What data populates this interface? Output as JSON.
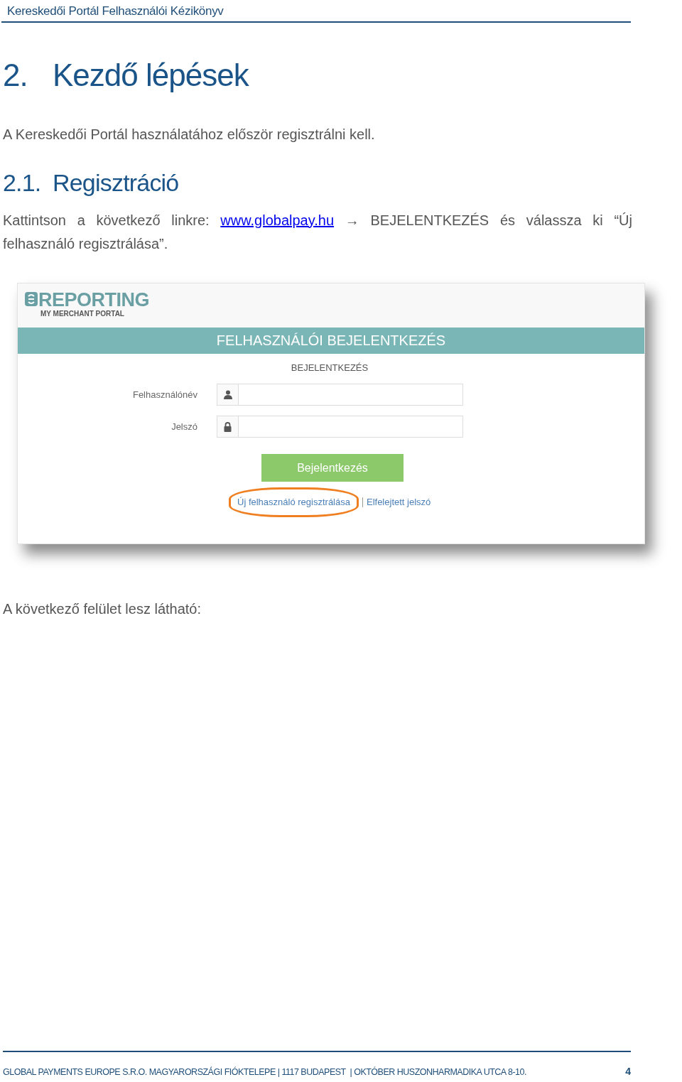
{
  "header": {
    "title": "Kereskedői Portál Felhasználói Kézikönyv"
  },
  "heading": {
    "number": "2.",
    "title": "Kezdő lépések"
  },
  "intro": "A Kereskedői Portál használatához először regisztrálni kell.",
  "subheading": {
    "number": "2.1.",
    "title": "Regisztráció"
  },
  "instruction": {
    "before": "Kattintson a következő linkre: ",
    "link": "www.globalpay.hu",
    "after": " → BEJELENTKEZÉS és válassza ki “Új felhasználó regisztrálása”."
  },
  "screenshot": {
    "logo_title": "REPORTING",
    "logo_subtitle": "MY MERCHANT PORTAL",
    "banner": "FELHASZNÁLÓI BEJELENTKEZÉS",
    "section": "BEJELENTKEZÉS",
    "fields": [
      {
        "label": "Felhasználónév",
        "kind": "user"
      },
      {
        "label": "Jelszó",
        "kind": "password"
      }
    ],
    "button": "Bejelentkezés",
    "links": [
      {
        "label": "Új felhasználó regisztrálása",
        "highlighted": true
      },
      {
        "label": "Elfelejtett jelszó",
        "highlighted": false
      }
    ]
  },
  "outro": "A következő felület lesz látható:",
  "footer": {
    "text": "GLOBAL PAYMENTS EUROPE S.R.O. MAGYARORSZÁGI FIÓKTELEPE | 1117 BUDAPEST  | OKTÓBER HUSZONHARMADIKA UTCA 8-10.",
    "page": "4"
  }
}
